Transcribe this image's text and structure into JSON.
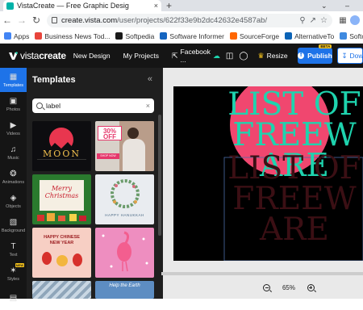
{
  "browser": {
    "tab_title": "VistaCreate — Free Graphic Desig",
    "tab_close": "×",
    "new_tab": "+",
    "window_controls": {
      "chevron": "⌄",
      "minimize": "–"
    },
    "url_host": "create.vista.com",
    "url_path": "/user/projects/622f33e9b2dc42632e4587ab/",
    "bookmarks": [
      {
        "label": "Apps",
        "icon": "apps-grid-icon",
        "color": "#4285f4"
      },
      {
        "label": "Business News Tod...",
        "icon": "globe-icon",
        "color": "#e8453c"
      },
      {
        "label": "Softpedia",
        "icon": "softpedia-s-icon",
        "color": "#1a1a1a"
      },
      {
        "label": "Software Informer",
        "icon": "software-informer-icon",
        "color": "#1565c0"
      },
      {
        "label": "SourceForge",
        "icon": "sourceforge-icon",
        "color": "#ff6600"
      },
      {
        "label": "AlternativeTo",
        "icon": "alternativeto-icon",
        "color": "#0b63b6"
      },
      {
        "label": "Softonic",
        "icon": "softonic-icon",
        "color": "#3f8ae0"
      }
    ]
  },
  "header": {
    "logo_text_a": "vista",
    "logo_text_b": "create",
    "new_design": "New Design",
    "my_projects": "My Projects",
    "facebook": "Facebook ...",
    "resize": "Resize",
    "publish": "Publish",
    "publish_badge": "BETA",
    "download": "Down",
    "colors": {
      "publish": "#1e73e8",
      "bg": "#151515"
    }
  },
  "rail": [
    {
      "label": "Templates",
      "icon": "templates-grid-icon",
      "active": true
    },
    {
      "label": "Photos",
      "icon": "photo-icon"
    },
    {
      "label": "Videos",
      "icon": "video-icon"
    },
    {
      "label": "Music",
      "icon": "music-note-icon"
    },
    {
      "label": "Animations",
      "icon": "animation-icon"
    },
    {
      "label": "Objects",
      "icon": "objects-icon"
    },
    {
      "label": "Background",
      "icon": "background-icon"
    },
    {
      "label": "Text",
      "icon": "text-icon"
    },
    {
      "label": "Styles",
      "icon": "styles-icon",
      "badge": "NEW"
    },
    {
      "label": "",
      "icon": "more-icon"
    }
  ],
  "panel": {
    "title": "Templates",
    "collapse": "«",
    "search_value": "label",
    "clear": "×",
    "templates": [
      {
        "name": "moon-template",
        "text": "MOON"
      },
      {
        "name": "sale-template",
        "text": "30% OFF",
        "text2": "SHOP NOW"
      },
      {
        "name": "christmas-template",
        "text": "Merry Christmas"
      },
      {
        "name": "hanukkah-template",
        "text": "HAPPY HANUKKAH"
      },
      {
        "name": "chinese-new-year-template",
        "text": "HAPPY CHINESE NEW YEAR"
      },
      {
        "name": "flamingo-template",
        "text": ""
      },
      {
        "name": "winter-template",
        "text": ""
      },
      {
        "name": "earth-template",
        "text": "Help the Earth"
      }
    ]
  },
  "canvas": {
    "line1": "LIST OF",
    "line2": "FREEW",
    "line3": "ARE",
    "zoom": "65%",
    "colors": {
      "text": "#1ed3ae",
      "circle": "#f0476f",
      "shadow": "#3b0f14"
    }
  }
}
